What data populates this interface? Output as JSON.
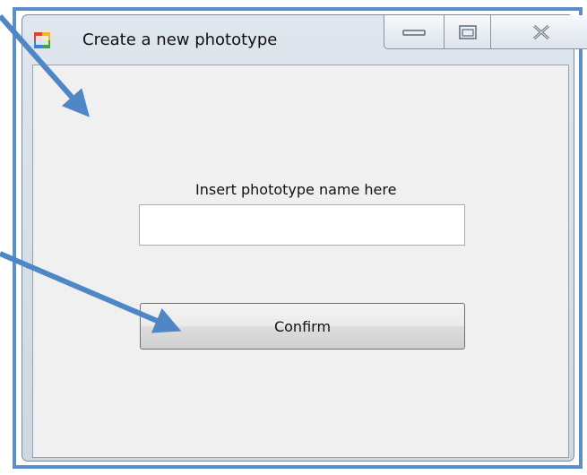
{
  "window": {
    "title": "Create a new phototype",
    "border_color": "#5a8fca"
  },
  "form": {
    "prompt_label": "Insert phototype name here",
    "name_value": "",
    "confirm_label": "Confirm"
  },
  "caption_buttons": {
    "minimize_icon": "minimize-icon",
    "maximize_icon": "maximize-icon",
    "close_icon": "close-icon"
  },
  "annotations": {
    "arrow_color": "#4f86c6"
  }
}
